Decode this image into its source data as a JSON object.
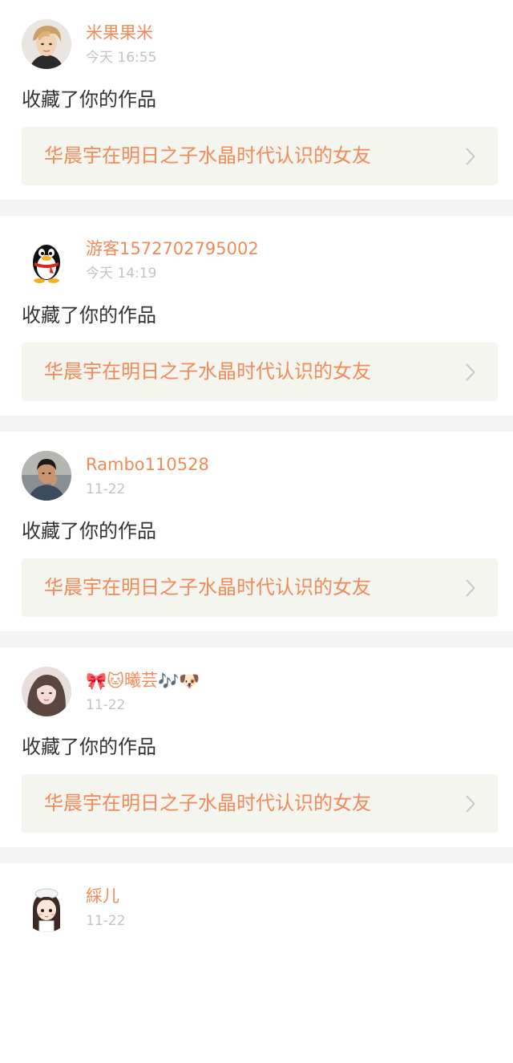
{
  "notifications": [
    {
      "username": "米果果米",
      "time": "今天 16:55",
      "action": "收藏了你的作品",
      "work_title": "华晨宇在明日之子水晶时代认识的女友",
      "avatar": "photo-avatar-man-blond"
    },
    {
      "username": "游客1572702795002",
      "time": "今天 14:19",
      "action": "收藏了你的作品",
      "work_title": "华晨宇在明日之子水晶时代认识的女友",
      "avatar": "qq-penguin-avatar"
    },
    {
      "username": "Rambo110528",
      "time": "11-22",
      "action": "收藏了你的作品",
      "work_title": "华晨宇在明日之子水晶时代认识的女友",
      "avatar": "photo-avatar-man-dark"
    },
    {
      "username_prefix": "🎀🐱",
      "username": "曦芸",
      "username_suffix": "🎶🐶",
      "time": "11-22",
      "action": "收藏了你的作品",
      "work_title": "华晨宇在明日之子水晶时代认识的女友",
      "avatar": "photo-avatar-woman"
    },
    {
      "username": "綵儿",
      "time": "11-22",
      "avatar": "cartoon-girl-avatar"
    }
  ],
  "colors": {
    "accent": "#f08a58",
    "muted": "#c3c3c3",
    "card_bg": "#f5f5ef",
    "separator": "#f4f4f4"
  }
}
